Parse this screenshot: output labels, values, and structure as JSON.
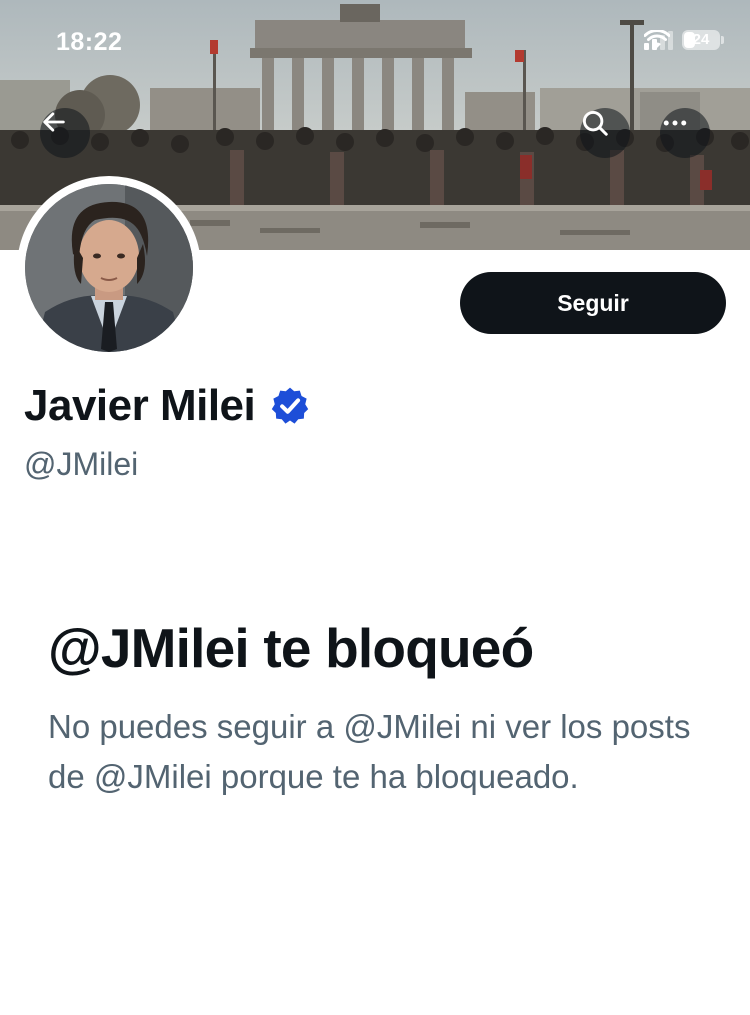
{
  "status_bar": {
    "time": "18:22",
    "battery_level": "24",
    "icons": [
      "signal-icon",
      "wifi-icon",
      "battery-icon"
    ]
  },
  "nav": {
    "back_icon": "arrow-left-icon",
    "search_icon": "search-icon",
    "more_icon": "more-horizontal-icon"
  },
  "profile": {
    "display_name": "Javier Milei",
    "handle": "@JMilei",
    "verified": true,
    "verified_color": "#1d4ed8",
    "follow_label": "Seguir"
  },
  "blocked": {
    "title": "@JMilei te bloqueó",
    "description": "No puedes seguir a @JMilei ni ver los posts de @JMilei porque te ha bloqueado."
  },
  "colors": {
    "text_primary": "#0f1419",
    "text_secondary": "#536471",
    "button_bg": "#0f1419",
    "button_text": "#ffffff"
  }
}
